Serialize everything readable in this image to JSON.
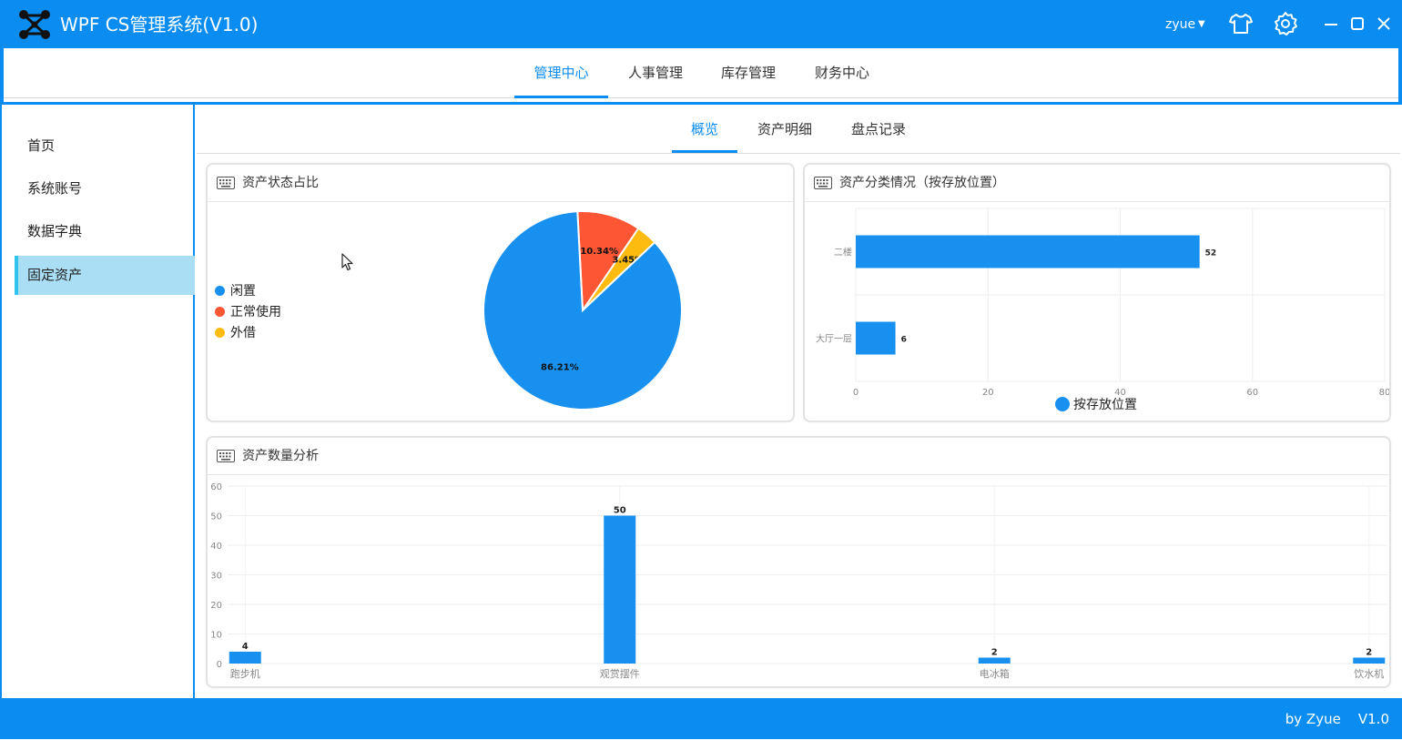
{
  "app": {
    "title": "WPF CS管理系统(V1.0)",
    "user": "zyue"
  },
  "topnav": {
    "items": [
      "管理中心",
      "人事管理",
      "库存管理",
      "财务中心"
    ],
    "active": 0
  },
  "sidebar": {
    "items": [
      "首页",
      "系统账号",
      "数据字典",
      "固定资产"
    ],
    "active": 3
  },
  "subtabs": {
    "items": [
      "概览",
      "资产明细",
      "盘点记录"
    ],
    "active": 0
  },
  "cards": {
    "status": {
      "title": "资产状态占比"
    },
    "location": {
      "title": "资产分类情况（按存放位置）"
    },
    "quantity": {
      "title": "资产数量分析"
    }
  },
  "footer": {
    "text": "by Zyue    V1.0"
  },
  "colors": {
    "primary": "#0a8cf0",
    "series_blue": "#1890f0",
    "red": "#fd5634",
    "amber": "#fdbb0f",
    "sidebar_active": "#a9def4"
  },
  "icons": [
    "logo-icon",
    "tshirt-icon",
    "gear-icon",
    "minimize-icon",
    "maximize-icon",
    "close-icon",
    "keyboard-icon"
  ],
  "chart_data": [
    {
      "type": "pie",
      "labels": [
        "闲置",
        "正常使用",
        "外借"
      ],
      "values": [
        86.21,
        10.34,
        3.45
      ],
      "value_labels": [
        "86.21%",
        "10.34%",
        "3.45%"
      ],
      "colors": [
        "#1890f0",
        "#fd5634",
        "#fdbb0f"
      ],
      "legend": "left"
    },
    {
      "type": "bar",
      "orientation": "horizontal",
      "categories": [
        "二楼",
        "大厅一层"
      ],
      "series": [
        {
          "name": "按存放位置",
          "values": [
            52,
            6
          ]
        }
      ],
      "xlim": [
        0,
        80
      ],
      "xticks": [
        0,
        20,
        40,
        60,
        80
      ],
      "grid": true,
      "legend": "bottom"
    },
    {
      "type": "bar",
      "categories": [
        "跑步机",
        "观赏摆件",
        "电冰箱",
        "饮水机"
      ],
      "values": [
        4,
        50,
        2,
        2
      ],
      "ylim": [
        0,
        60
      ],
      "yticks": [
        0,
        10,
        20,
        30,
        40,
        50,
        60
      ],
      "grid": true
    }
  ]
}
